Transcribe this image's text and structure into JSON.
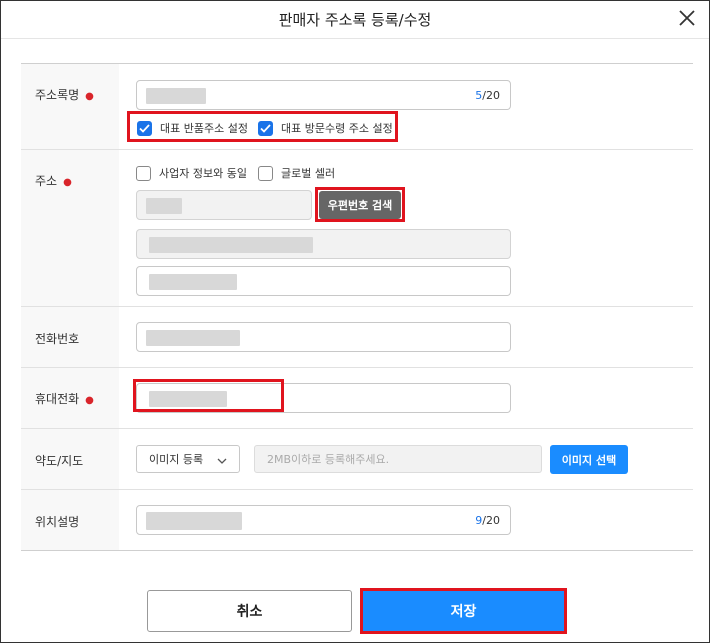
{
  "modal": {
    "title": "판매자 주소록 등록/수정",
    "close_label": ""
  },
  "fields": {
    "name": {
      "label": "주소록명",
      "count": "5",
      "max": "/20"
    },
    "checks": {
      "return_label": "대표 반품주소 설정",
      "visit_label": "대표 방문수령 주소 설정"
    },
    "address": {
      "label": "주소",
      "same_as_business": "사업자 정보와 동일",
      "global_seller": "글로벌 셀러",
      "zip_search": "우편번호 검색"
    },
    "phone": {
      "label": "전화번호"
    },
    "mobile": {
      "label": "휴대전화"
    },
    "map": {
      "label": "약도/지도",
      "select_value": "이미지 등록",
      "placeholder": "2MB이하로 등록해주세요.",
      "choose_button": "이미지 선택"
    },
    "location": {
      "label": "위치설명",
      "count": "9",
      "max": "/20"
    }
  },
  "footer": {
    "cancel": "취소",
    "save": "저장"
  },
  "colors": {
    "accent": "#1a8cff",
    "highlight": "#e0141e",
    "required": "#d9252b"
  }
}
